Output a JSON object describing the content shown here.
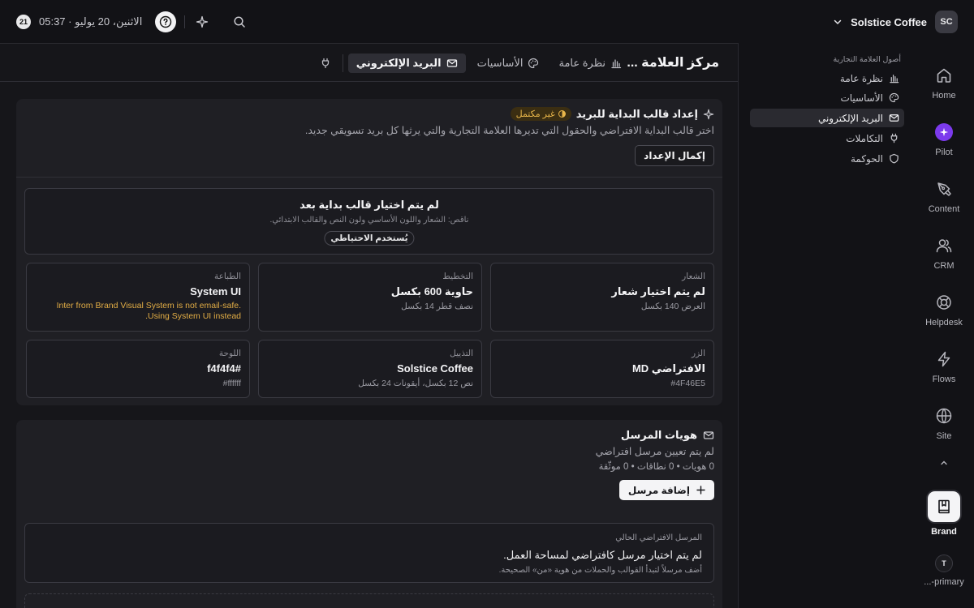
{
  "topbar": {
    "date_badge": "21",
    "time": "05:37",
    "date": "الاثنين، 20 يوليو",
    "workspace_name": "Solstice Coffee",
    "workspace_initials": "SC"
  },
  "header": {
    "page_title": "مركز العلامة ...",
    "tabs": [
      {
        "label": "نظرة عامة",
        "icon": "bar-chart-icon"
      },
      {
        "label": "الأساسيات",
        "icon": "palette-icon"
      },
      {
        "label": "البريد الإلكتروني",
        "icon": "mail-icon",
        "active": true
      }
    ],
    "extra_tab_icon": "plug-icon"
  },
  "setup_card": {
    "title": "إعداد قالب البداية للبريد",
    "status_badge": "غير مكتمل",
    "description": "اختر قالب البداية الافتراضي والحقول التي تديرها العلامة التجارية والتي يرثها كل بريد تسويقي جديد.",
    "complete_button": "إكمال الإعداد",
    "empty_title": "لم يتم اختيار قالب بداية بعد",
    "empty_subtitle": "ناقص: الشعار واللون الأساسي ولون النص والقالب الابتدائي.",
    "fallback_pill": "يُستخدم الاحتياطي",
    "tiles": [
      {
        "label": "الشعار",
        "value": "لم يتم اختيار شعار",
        "sub": "العرض 140 بكسل"
      },
      {
        "label": "التخطيط",
        "value": "حاوية 600 بكسل",
        "sub": "نصف قطر 14 بكسل"
      },
      {
        "label": "الطباعة",
        "value": "System UI",
        "warning": "Inter from Brand Visual System is not email-safe. Using System UI instead."
      },
      {
        "label": "الزر",
        "value": "الافتراضي MD",
        "sub": "#4F46E5"
      },
      {
        "label": "التذييل",
        "value": "Solstice Coffee",
        "sub": "نص 12 بكسل، أيقونات 24 بكسل"
      },
      {
        "label": "اللوحة",
        "value": "f4f4f4#",
        "sub": "ffffff#"
      }
    ]
  },
  "sender_card": {
    "title": "هويات المرسل",
    "subtitle": "لم يتم تعيين مرسل افتراضي",
    "stats": "0 هويات • 0 نطاقات • 0 موثّقة",
    "add_button": "إضافة مرسل",
    "current_label": "المرسل الافتراضي الحالي",
    "current_value": "لم يتم اختيار مرسل كافتراضي لمساحة العمل.",
    "current_hint": "أضف مرسلاً لتبدأ القوالب والحملات من هوية «من» الصحيحة."
  },
  "subnav": {
    "heading": "أصول العلامة التجارية",
    "items": [
      {
        "label": "نظرة عامة",
        "icon": "bar-chart-icon"
      },
      {
        "label": "الأساسيات",
        "icon": "palette-icon"
      },
      {
        "label": "البريد الإلكتروني",
        "icon": "mail-icon",
        "active": true
      },
      {
        "label": "التكاملات",
        "icon": "plug-icon"
      },
      {
        "label": "الحوكمة",
        "icon": "shield-icon"
      }
    ]
  },
  "rail": {
    "items": [
      "Home",
      "Pilot",
      "Content",
      "CRM",
      "Helpdesk",
      "Flows",
      "Site"
    ],
    "brand": "Brand",
    "user_initial": "T",
    "user_label": "...-primary"
  },
  "colors": {
    "accent_pilot": "#7c3aed",
    "warning": "#e9b64a",
    "background": "#121216"
  }
}
